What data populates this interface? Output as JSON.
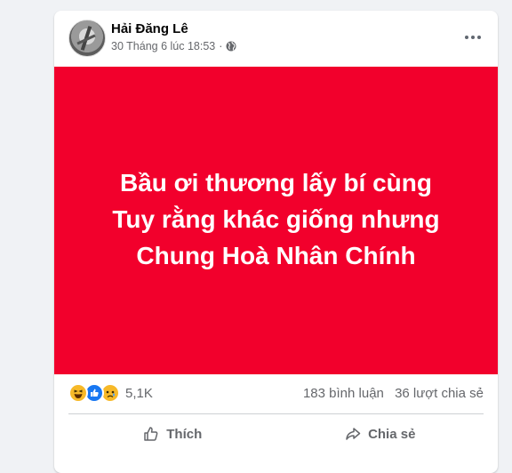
{
  "post": {
    "author": "Hải Đăng Lê",
    "date": "30 Tháng 6 lúc 18:53",
    "separator": "·",
    "text_lines": [
      "Bầu ơi thương lấy bí cùng",
      "Tuy rằng khác giống nhưng",
      "Chung Hoà Nhân Chính"
    ],
    "background_color": "#f2002c"
  },
  "stats": {
    "reactions": [
      "haha",
      "like",
      "sad"
    ],
    "reaction_count": "5,1K",
    "comments": "183 bình luận",
    "shares": "36 lượt chia sẻ"
  },
  "actions": {
    "like_label": "Thích",
    "share_label": "Chia sẻ"
  }
}
